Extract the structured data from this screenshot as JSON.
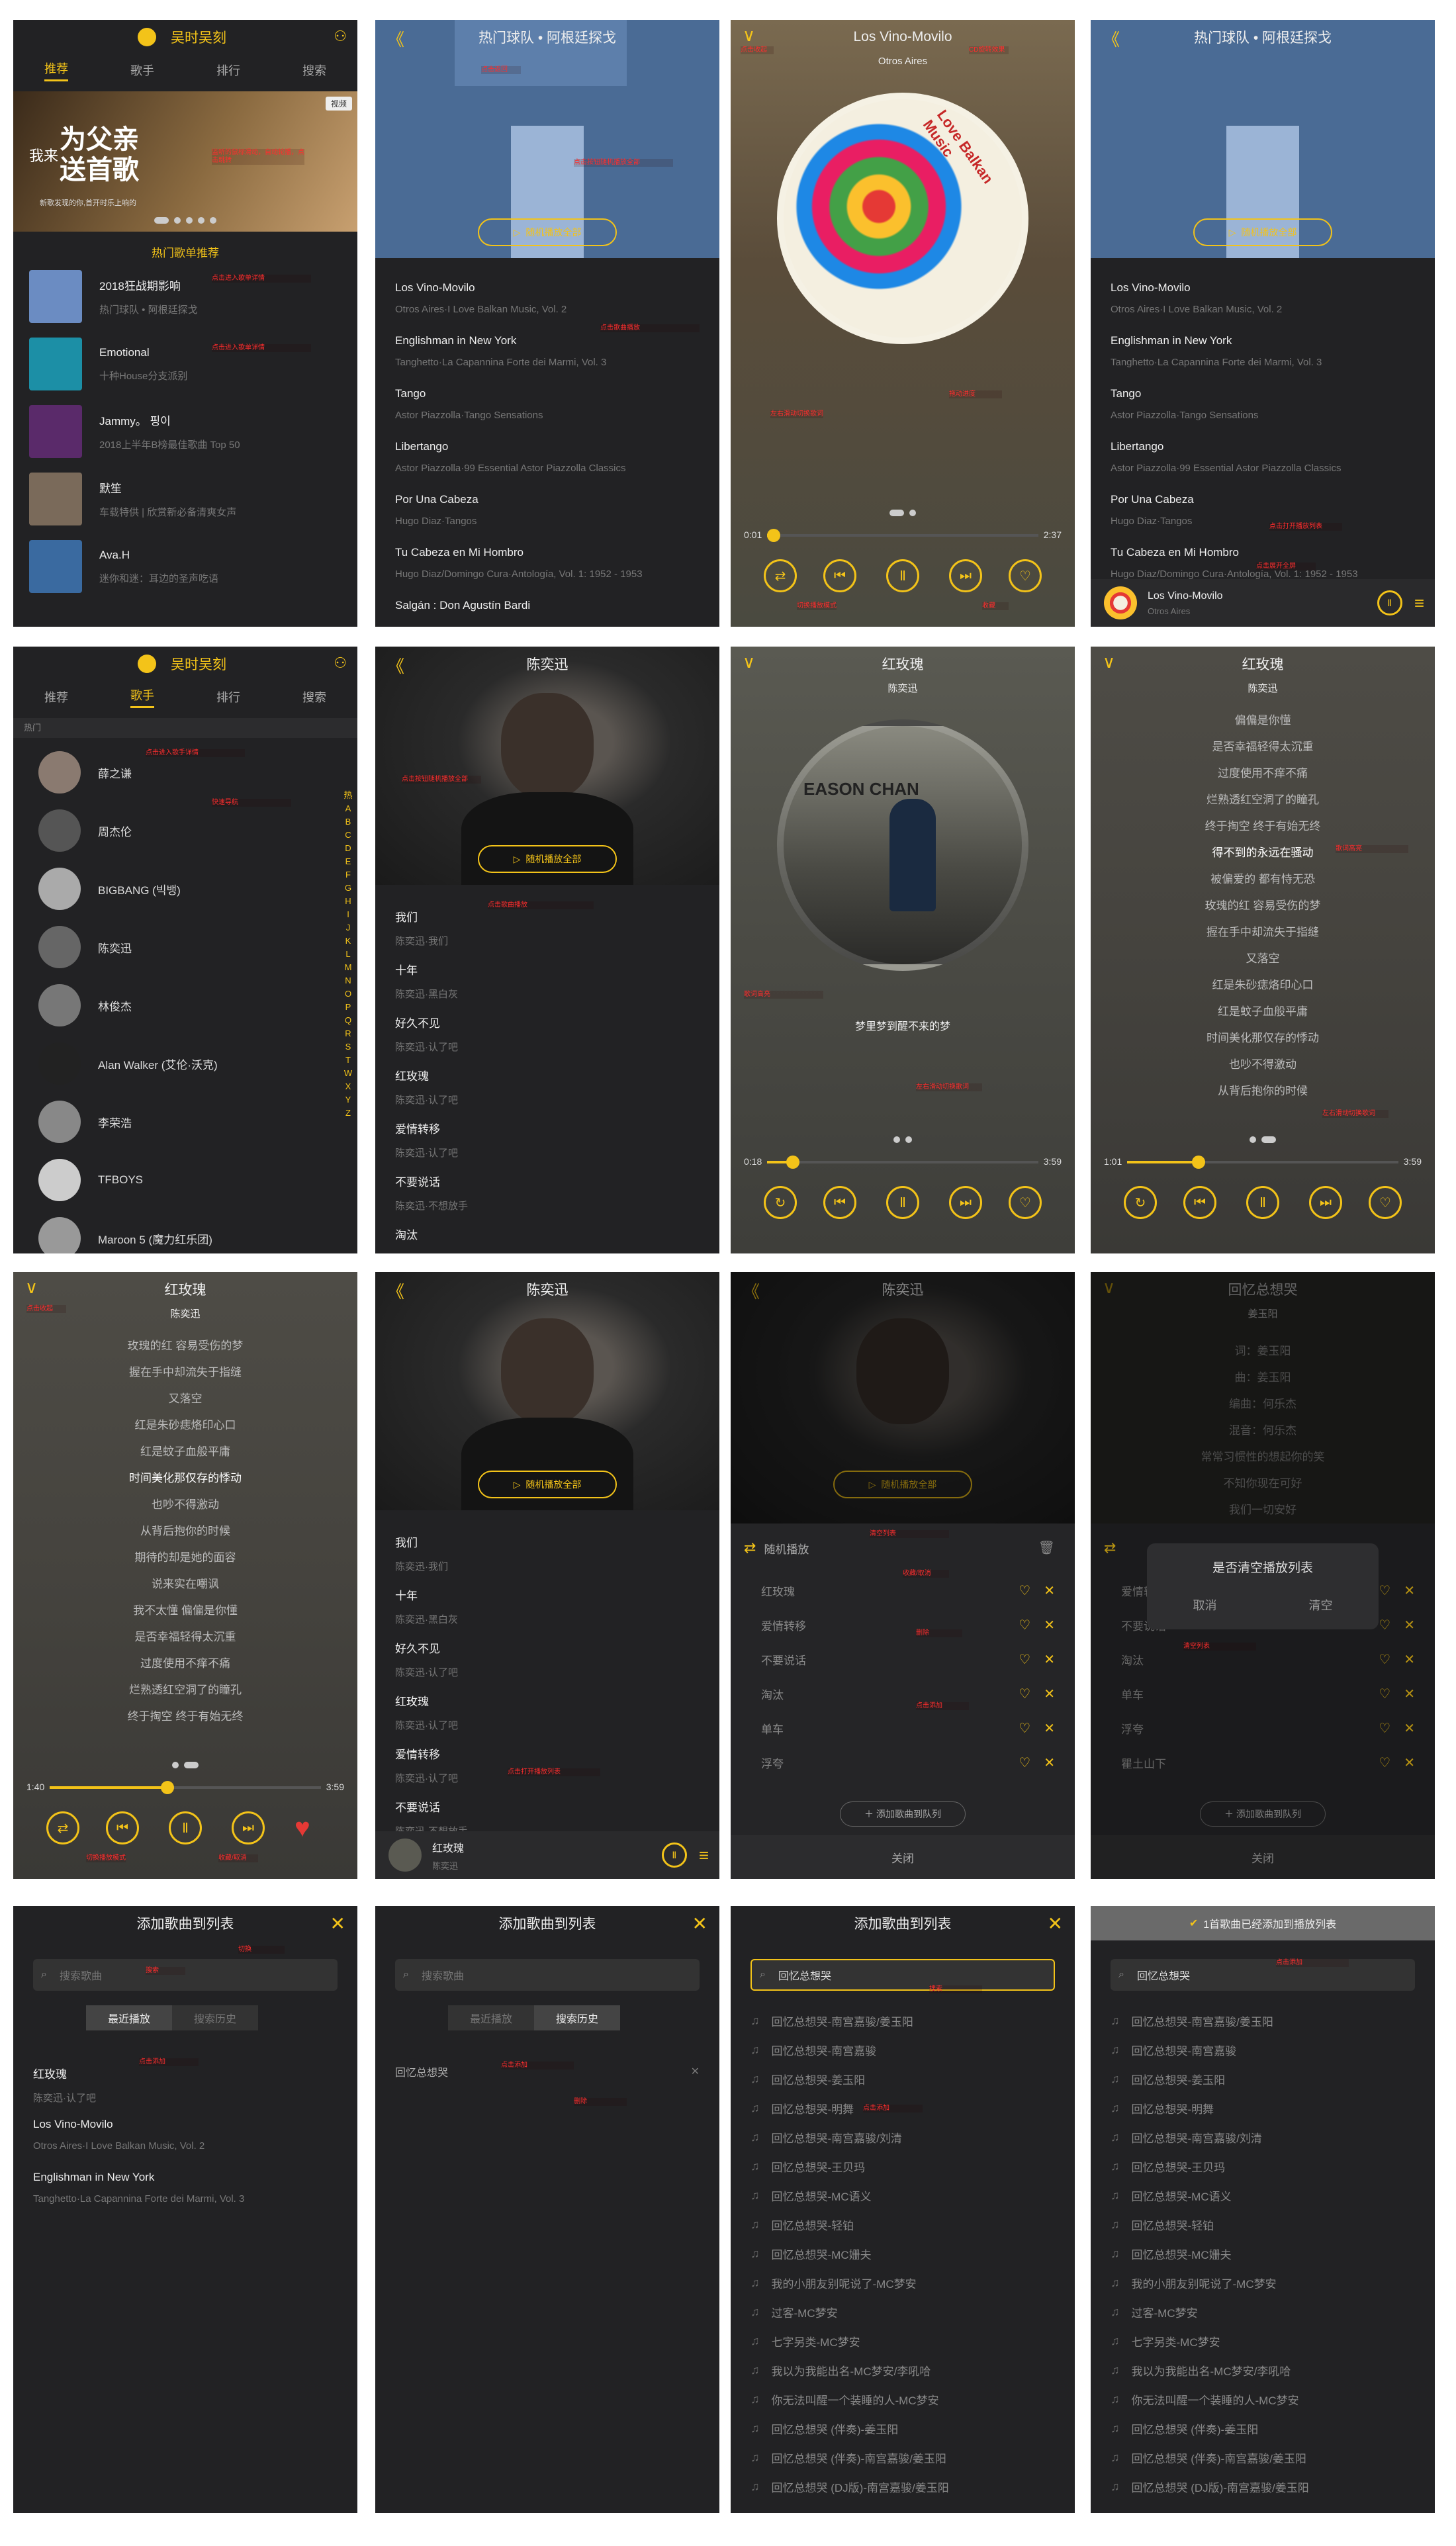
{
  "app": {
    "title": "吴时吴刻",
    "tabs": [
      "推荐",
      "歌手",
      "排行",
      "搜索"
    ]
  },
  "home": {
    "banner_badge": "视频",
    "banner_title": "为父亲送首歌",
    "banner_pre": "我来",
    "banner_sub": "新歌发现的你,首开时乐上响的",
    "section": "热门歌单推荐",
    "playlists": [
      {
        "title": "2018狂战期影响",
        "sub": "热门球队 • 阿根廷探戈"
      },
      {
        "title": "Emotional",
        "sub": "十种House分支派别"
      },
      {
        "title": "Jammy。 핑이",
        "sub": "2018上半年B榜最佳歌曲 Top 50"
      },
      {
        "title": "默笙",
        "sub": "车载特供 | 欣赏新必备清爽女声"
      },
      {
        "title": "Ava.H",
        "sub": "迷你和迷：耳边的圣声吃语"
      }
    ]
  },
  "playlist": {
    "title": "热门球队 • 阿根廷探戈",
    "play_all": "随机播放全部",
    "songs": [
      {
        "t": "Los Vino-Movilo",
        "s": "Otros Aires·I Love Balkan Music, Vol. 2"
      },
      {
        "t": "Englishman in New York",
        "s": "Tanghetto·La Capannina Forte dei Marmi, Vol. 3"
      },
      {
        "t": "Tango",
        "s": "Astor Piazzolla·Tango Sensations"
      },
      {
        "t": "Libertango",
        "s": "Astor Piazzolla·99 Essential Astor Piazzolla Classics"
      },
      {
        "t": "Por Una Cabeza",
        "s": "Hugo Diaz·Tangos"
      },
      {
        "t": "Tu Cabeza en Mi Hombro",
        "s": "Hugo Diaz/Domingo Cura·Antología, Vol. 1: 1952 - 1953"
      },
      {
        "t": "Salgán : Don Agustín Bardi",
        "s": ""
      }
    ]
  },
  "player1": {
    "title": "Los Vino-Movilo",
    "artist": "Otros Aires",
    "cd_text": "Love Balkan Music",
    "time_cur": "0:01",
    "time_total": "2:37",
    "progress": 0.01
  },
  "mini1": {
    "title": "Los Vino-Movilo",
    "artist": "Otros Aires"
  },
  "singers": {
    "hot": "热门",
    "list": [
      "薛之谦",
      "周杰伦",
      "BIGBANG (빅뱅)",
      "陈奕迅",
      "林俊杰",
      "Alan Walker (艾伦·沃克)",
      "李荣浩",
      "TFBOYS",
      "Maroon 5 (魔力红乐团)"
    ],
    "index": [
      "热",
      "A",
      "B",
      "C",
      "D",
      "E",
      "F",
      "G",
      "H",
      "I",
      "J",
      "K",
      "L",
      "M",
      "N",
      "O",
      "P",
      "Q",
      "R",
      "S",
      "T",
      "W",
      "X",
      "Y",
      "Z"
    ]
  },
  "singer": {
    "name": "陈奕迅",
    "play_all": "随机播放全部",
    "songs": [
      {
        "t": "我们",
        "s": "陈奕迅·我们"
      },
      {
        "t": "十年",
        "s": "陈奕迅·黑白灰"
      },
      {
        "t": "好久不见",
        "s": "陈奕迅·认了吧"
      },
      {
        "t": "红玫瑰",
        "s": "陈奕迅·认了吧"
      },
      {
        "t": "爱情转移",
        "s": "陈奕迅·认了吧"
      },
      {
        "t": "不要说话",
        "s": "陈奕迅·不想放手"
      },
      {
        "t": "淘汰",
        "s": "陈奕迅·认了吧"
      }
    ]
  },
  "player2": {
    "title": "红玫瑰",
    "artist": "陈奕迅",
    "cd_text": "EASON CHAN",
    "lyric_line": "梦里梦到醒不来的梦",
    "time_cur": "0:18",
    "time_total": "3:59",
    "progress": 0.08
  },
  "player3": {
    "title": "红玫瑰",
    "artist": "陈奕迅",
    "time_cur": "1:01",
    "time_total": "3:59",
    "progress": 0.25,
    "lyrics": [
      "偏偏是你懂",
      "是否幸福轻得太沉重",
      "过度使用不痒不痛",
      "烂熟透红空洞了的瞳孔",
      "终于掏空 终于有始无终",
      "得不到的永远在骚动",
      "被偏爱的 都有恃无恐",
      "玫瑰的红 容易受伤的梦",
      "握在手中却流失于指缝",
      "又落空",
      "红是朱砂痣烙印心口",
      "红是蚊子血般平庸",
      "时间美化那仅存的悸动",
      "也吵不得激动",
      "从背后抱你的时候"
    ]
  },
  "player4": {
    "title": "红玫瑰",
    "artist": "陈奕迅",
    "time_cur": "1:40",
    "time_total": "3:59",
    "progress": 0.42,
    "lyrics": [
      "玫瑰的红 容易受伤的梦",
      "握在手中却流失于指缝",
      "又落空",
      "红是朱砂痣烙印心口",
      "红是蚊子血般平庸",
      "时间美化那仅存的悸动",
      "也吵不得激动",
      "从背后抱你的时候",
      "期待的却是她的面容",
      "说来实在嘲讽",
      "我不太懂 偏偏是你懂",
      "是否幸福轻得太沉重",
      "过度使用不痒不痛",
      "烂熟透红空洞了的瞳孔",
      "终于掏空 终于有始无终"
    ]
  },
  "mini2": {
    "title": "红玫瑰",
    "artist": "陈奕迅"
  },
  "queue": {
    "mode": "随机播放",
    "add_btn": "添加歌曲到队列",
    "close": "关闭",
    "items": [
      "红玫瑰",
      "爱情转移",
      "不要说话",
      "淘汰",
      "单车",
      "浮夸"
    ]
  },
  "player5": {
    "title": "回忆总想哭",
    "artist": "姜玉阳",
    "lyrics": [
      "词：姜玉阳",
      "曲：姜玉阳",
      "编曲：何乐杰",
      "混音：何乐杰",
      "常常习惯性的想起你的笑",
      "不知你现在可好",
      "我们一切安好"
    ],
    "queue_items": [
      "爱情转移",
      "不要说话",
      "淘汰",
      "单车",
      "浮夸",
      "瞿土山下"
    ]
  },
  "confirm": {
    "text": "是否清空播放列表",
    "cancel": "取消",
    "ok": "清空"
  },
  "add": {
    "title": "添加歌曲到列表",
    "placeholder": "搜索歌曲",
    "seg": [
      "最近播放",
      "搜索历史"
    ],
    "recent": [
      {
        "t": "红玫瑰",
        "s": "陈奕迅·认了吧"
      },
      {
        "t": "Los Vino-Movilo",
        "s": "Otros Aires·I Love Balkan Music, Vol. 2"
      },
      {
        "t": "Englishman in New York",
        "s": "Tanghetto·La Capannina Forte dei Marmi, Vol. 3"
      }
    ],
    "history_item": "回忆总想哭",
    "query": "回忆总想哭",
    "toast": "1首歌曲已经添加到播放列表",
    "results": [
      "回忆总想哭-南宫嘉骏/姜玉阳",
      "回忆总想哭-南宫嘉骏",
      "回忆总想哭-姜玉阳",
      "回忆总想哭-明舞",
      "回忆总想哭-南宫嘉骏/刘清",
      "回忆总想哭-王贝玛",
      "回忆总想哭-MC语义",
      "回忆总想哭-轻铂",
      "回忆总想哭-MC姗夫",
      "我的小朋友别呢说了-MC梦安",
      "过客-MC梦安",
      "七字另类-MC梦安",
      "我以为我能出名-MC梦安/李吼哈",
      "你无法叫醒一个装睡的人-MC梦安",
      "回忆总想哭 (伴奏)-姜玉阳",
      "回忆总想哭 (伴奏)-南宫嘉骏/姜玉阳",
      "回忆总想哭 (DJ版)-南宫嘉骏/姜玉阳"
    ]
  },
  "notes": [
    "监听的鼠标滑动",
    "自动轮播，点击跳转",
    "点击进入歌单详情",
    "点击按钮随机播放全部",
    "点击歌曲播放",
    "点击收起",
    "CD旋转效果",
    "上一曲",
    "下一曲",
    "暂停/播放",
    "切换播放模式",
    "收藏",
    "点击打开播放列表",
    "点击展开全屏",
    "点击进入歌手详情",
    "快速导航",
    "左右滑动切换歌词",
    "拖动进度",
    "歌词高亮",
    "删除",
    "清空列表",
    "收藏/取消",
    "搜索",
    "切换",
    "点击添加"
  ],
  "colors": {
    "accent": "#f3c319",
    "bg": "#222224",
    "annot": "#ff2e2e"
  }
}
